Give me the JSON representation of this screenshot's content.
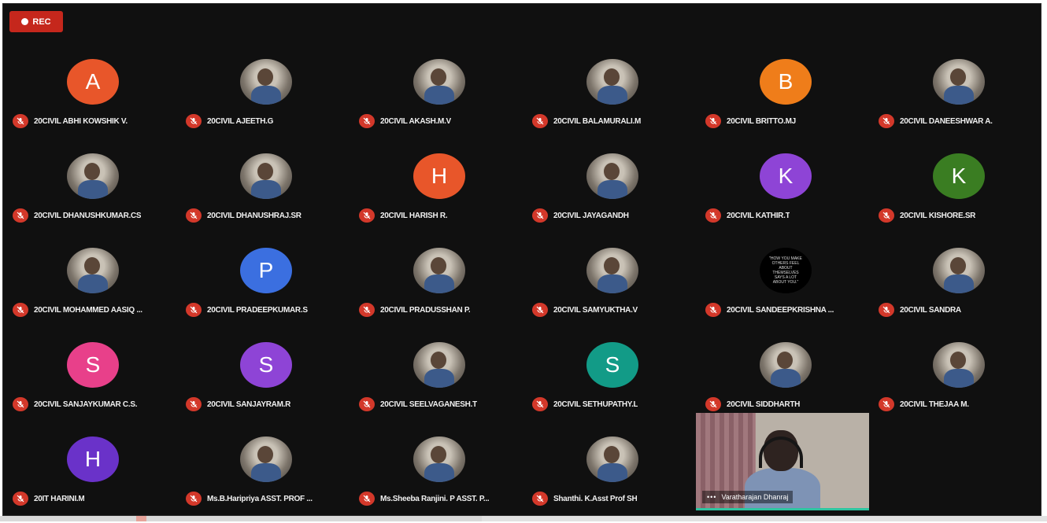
{
  "recording": {
    "label": "REC"
  },
  "participants": [
    {
      "name": "20CIVIL ABHI KOWSHIK V.",
      "initial": "A",
      "color": "#e8562a"
    },
    {
      "name": "20CIVIL AJEETH.G",
      "initial": "",
      "color": ""
    },
    {
      "name": "20CIVIL AKASH.M.V",
      "initial": "",
      "color": ""
    },
    {
      "name": "20CIVIL BALAMURALI.M",
      "initial": "",
      "color": ""
    },
    {
      "name": "20CIVIL BRITTO.MJ",
      "initial": "B",
      "color": "#ef7d1a"
    },
    {
      "name": "20CIVIL DANEESHWAR A.",
      "initial": "",
      "color": ""
    },
    {
      "name": "20CIVIL DHANUSHKUMAR.CS",
      "initial": "",
      "color": ""
    },
    {
      "name": "20CIVIL DHANUSHRAJ.SR",
      "initial": "",
      "color": ""
    },
    {
      "name": "20CIVIL HARISH R.",
      "initial": "H",
      "color": "#e8562a"
    },
    {
      "name": "20CIVIL JAYAGANDH",
      "initial": "",
      "color": ""
    },
    {
      "name": "20CIVIL KATHIR.T",
      "initial": "K",
      "color": "#8e44d6"
    },
    {
      "name": "20CIVIL KISHORE.SR",
      "initial": "K",
      "color": "#3a7d22"
    },
    {
      "name": "20CIVIL MOHAMMED AASIQ ...",
      "initial": "",
      "color": ""
    },
    {
      "name": "20CIVIL PRADEEPKUMAR.S",
      "initial": "P",
      "color": "#3b6fe0"
    },
    {
      "name": "20CIVIL PRADUSSHAN P.",
      "initial": "",
      "color": ""
    },
    {
      "name": "20CIVIL SAMYUKTHA.V",
      "initial": "",
      "color": ""
    },
    {
      "name": "20CIVIL SANDEEPKRISHNA ...",
      "initial": "",
      "color": "",
      "quote": "\"HOW YOU MAKE OTHERS FEEL ABOUT THEMSELVES SAYS A LOT ABOUT YOU.\""
    },
    {
      "name": "20CIVIL SANDRA",
      "initial": "",
      "color": ""
    },
    {
      "name": "20CIVIL SANJAYKUMAR C.S.",
      "initial": "S",
      "color": "#e8408a"
    },
    {
      "name": "20CIVIL SANJAYRAM.R",
      "initial": "S",
      "color": "#8e44d6"
    },
    {
      "name": "20CIVIL SEELVAGANESH.T",
      "initial": "",
      "color": ""
    },
    {
      "name": "20CIVIL SETHUPATHY.L",
      "initial": "S",
      "color": "#129b87"
    },
    {
      "name": "20CIVIL SIDDHARTH",
      "initial": "",
      "color": ""
    },
    {
      "name": "20CIVIL THEJAA M.",
      "initial": "",
      "color": ""
    },
    {
      "name": "20IT HARINI.M",
      "initial": "H",
      "color": "#6a32c9"
    },
    {
      "name": "Ms.B.Haripriya ASST. PROF ...",
      "initial": "",
      "color": ""
    },
    {
      "name": "Ms.Sheeba Ranjini. P ASST. P...",
      "initial": "",
      "color": ""
    },
    {
      "name": "Shanthi. K.Asst Prof SH",
      "initial": "",
      "color": ""
    }
  ],
  "active_video": {
    "name": "Varatharajan Dhanraj"
  }
}
